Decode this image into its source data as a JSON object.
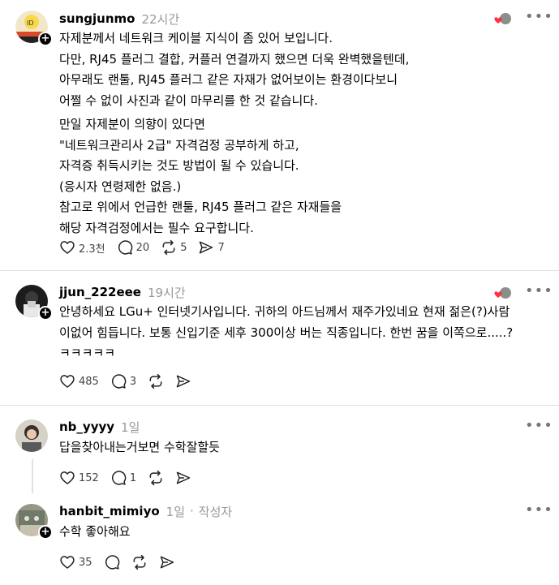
{
  "posts": [
    {
      "username": "sungjunmo",
      "time": "22시간",
      "body_p1": "자제분께서 네트워크 케이블 지식이 좀 있어 보입니다.\n다만, RJ45 플러그 결합, 커플러 연결까지 했으면 더욱 완벽했을텐데,\n아무래도 랜툴, RJ45 플러그 같은 자재가 없어보이는 환경이다보니\n어쩔 수 없이 사진과 같이 마무리를 한 것 같습니다.",
      "body_p2": "만일 자제분이 의향이 있다면\n\"네트워크관리사 2급\" 자격검정 공부하게 하고,\n자격증 취득시키는 것도 방법이 될 수 있습니다.\n(응시자 연령제한 없음.)\n참고로 위에서 언급한 랜툴, RJ45 플러그 같은 자재들을\n해당 자격검정에서는 필수 요구합니다.",
      "likes": "2.3천",
      "comments": "20",
      "reposts": "5",
      "shares": "7"
    },
    {
      "username": "jjun_222eee",
      "time": "19시간",
      "body": "안녕하세요 LGu+ 인터넷기사입니다. 귀하의 아드님께서 재주가있네요 현재 젊은(?)사람\n이없어 힘듭니다. 보통 신입기준 세후 300이상 버는 직종입니다. 한번 꿈을 이쪽으로.....?\nㅋㅋㅋㅋㅋ",
      "likes": "485",
      "comments": "3"
    },
    {
      "username": "nb_yyyy",
      "time": "1일",
      "body": "답을찾아내는거보면 수학잘할듯",
      "likes": "152",
      "comments": "1"
    },
    {
      "username": "hanbit_mimiyo",
      "time": "1일",
      "author_badge": "작성자",
      "body": "수학 좋아해요",
      "likes": "35"
    }
  ],
  "icons": {
    "like": "heart-icon",
    "comment": "comment-icon",
    "repost": "repost-icon",
    "share": "share-icon",
    "more": "more-icon",
    "follow": "plus-icon"
  },
  "colors": {
    "heart_liked": "#ff3040",
    "divider": "#e0e0e0",
    "muted": "#999999"
  }
}
